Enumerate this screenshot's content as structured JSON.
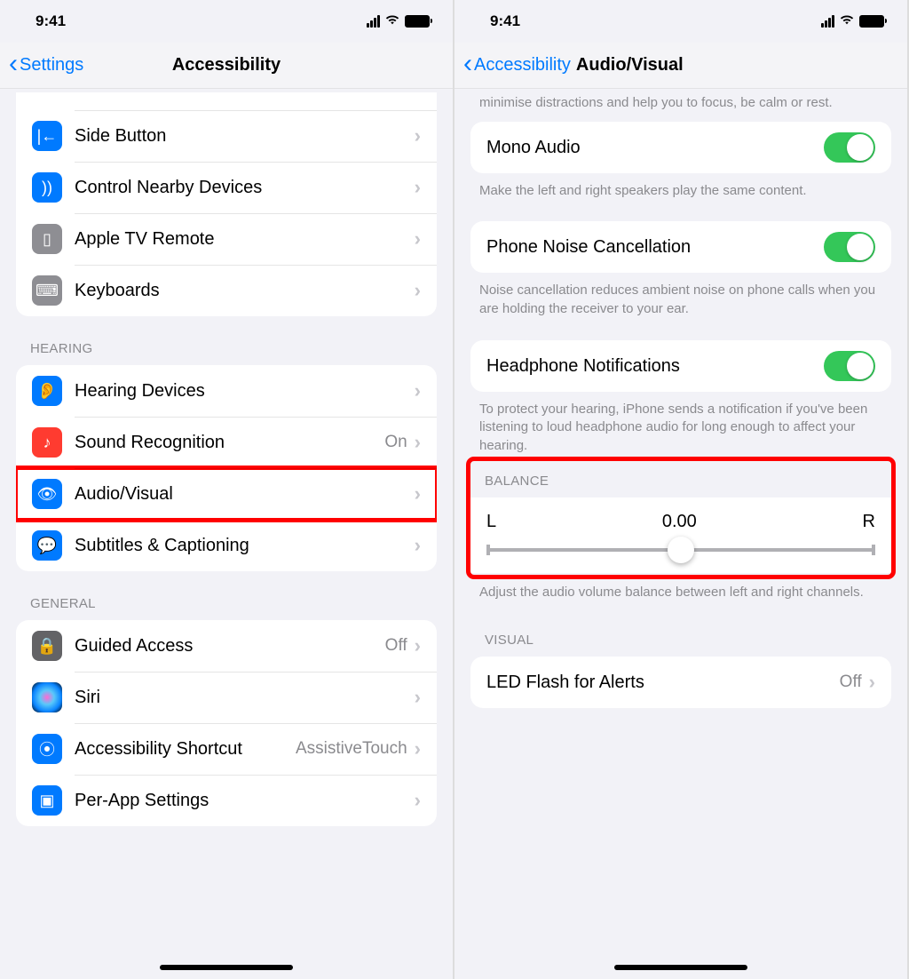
{
  "status": {
    "time": "9:41"
  },
  "left": {
    "back": "Settings",
    "title": "Accessibility",
    "groups": {
      "physical": [
        {
          "label": "Side Button"
        },
        {
          "label": "Control Nearby Devices"
        },
        {
          "label": "Apple TV Remote"
        },
        {
          "label": "Keyboards"
        }
      ],
      "hearing_header": "HEARING",
      "hearing": [
        {
          "label": "Hearing Devices"
        },
        {
          "label": "Sound Recognition",
          "detail": "On"
        },
        {
          "label": "Audio/Visual"
        },
        {
          "label": "Subtitles & Captioning"
        }
      ],
      "general_header": "GENERAL",
      "general": [
        {
          "label": "Guided Access",
          "detail": "Off"
        },
        {
          "label": "Siri"
        },
        {
          "label": "Accessibility Shortcut",
          "detail": "AssistiveTouch"
        },
        {
          "label": "Per-App Settings"
        }
      ]
    }
  },
  "right": {
    "back": "Accessibility",
    "title": "Audio/Visual",
    "partial_intro": "minimise distractions and help you to focus, be calm or rest.",
    "mono": {
      "label": "Mono Audio",
      "footer": "Make the left and right speakers play the same content."
    },
    "noise": {
      "label": "Phone Noise Cancellation",
      "footer": "Noise cancellation reduces ambient noise on phone calls when you are holding the receiver to your ear."
    },
    "headphone": {
      "label": "Headphone Notifications",
      "footer": "To protect your hearing, iPhone sends a notification if you've been listening to loud headphone audio for long enough to affect your hearing."
    },
    "balance": {
      "header": "BALANCE",
      "left": "L",
      "value": "0.00",
      "right": "R",
      "footer": "Adjust the audio volume balance between left and right channels."
    },
    "visual": {
      "header": "VISUAL",
      "led_label": "LED Flash for Alerts",
      "led_detail": "Off"
    }
  }
}
